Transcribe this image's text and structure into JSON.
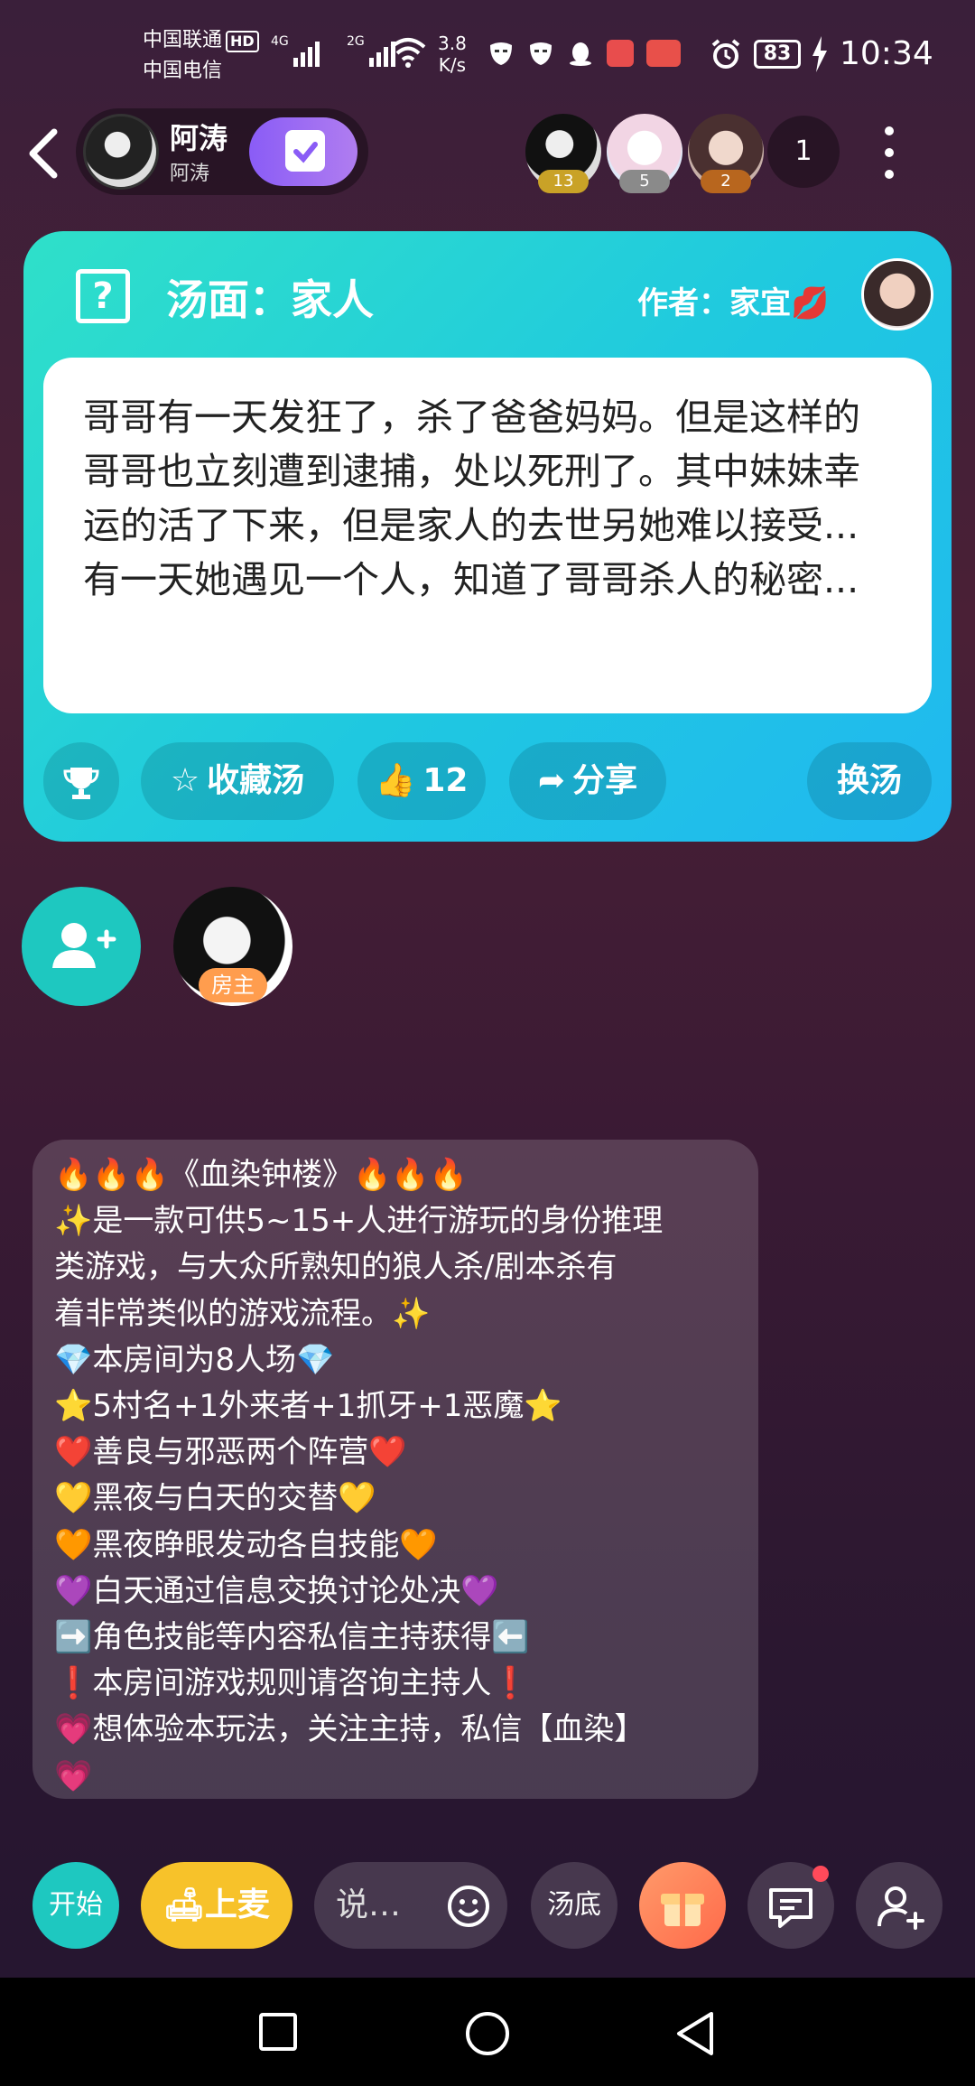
{
  "status_bar": {
    "carrier1": "中国联通",
    "hd": "HD",
    "carrier2": "中国电信",
    "sig1_label": "4G",
    "sig2_label": "2G",
    "net_speed_value": "3.8",
    "net_speed_unit": "K/s",
    "battery": "83",
    "time": "10:34"
  },
  "header": {
    "host_name": "阿涛",
    "host_id": "阿涛",
    "audience": [
      {
        "badge": "13",
        "color": "#c9a227"
      },
      {
        "badge": "5",
        "color": "#8a8a8a"
      },
      {
        "badge": "2",
        "color": "#b8661e"
      }
    ],
    "online_count": "1"
  },
  "soup_card": {
    "title": "汤面：家人",
    "author": "作者：家宜💋",
    "story": " 哥哥有一天发狂了，杀了爸爸妈妈。但是这样的哥哥也立刻遭到逮捕，处以死刑了。其中妹妹幸运的活了下来，但是家人的去世另她难以接受...有一天她遇见一个人，知道了哥哥杀人的秘密...",
    "collect_label": "收藏汤",
    "like_count": "12",
    "share_label": "分享",
    "change_label": "换汤"
  },
  "seats": {
    "owner_tag": "房主"
  },
  "notice_lines": [
    "🔥🔥🔥《血染钟楼》🔥🔥🔥",
    "✨是一款可供5~15+人进行游玩的身份推理",
    "类游戏，与大众所熟知的狼人杀/剧本杀有",
    "着非常类似的游戏流程。✨",
    "💎本房间为8人场💎",
    "⭐5村名+1外来者+1抓牙+1恶魔⭐",
    "❤️善良与邪恶两个阵营❤️",
    "💛黑夜与白天的交替💛",
    "🧡黑夜睁眼发动各自技能🧡",
    "💜白天通过信息交换讨论处决💜",
    "➡️角色技能等内容私信主持获得⬅️",
    "❗本房间游戏规则请咨询主持人❗",
    "💗想体验本玩法，关注主持，私信【血染】",
    "💗"
  ],
  "bottom_bar": {
    "start_label": "开始",
    "mic_label": "上麦",
    "input_placeholder": "说…",
    "answer_label": "汤底"
  },
  "colors": {
    "card_accent": "#1fc8e0",
    "mic_button": "#f7c22a",
    "start_button": "#1ec8c0",
    "gift_button": "#ff7a5a",
    "owner_tag": "#ff9d4e"
  }
}
